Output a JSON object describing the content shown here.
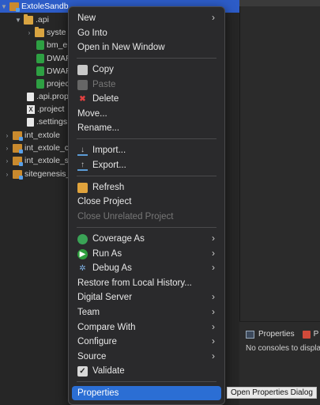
{
  "explorer": {
    "root": "ExtoleSandb",
    "items": [
      {
        "label": ".api"
      },
      {
        "label": "syste"
      },
      {
        "label": "bm_e"
      },
      {
        "label": "DWAR"
      },
      {
        "label": "DWAR"
      },
      {
        "label": "projec"
      },
      {
        "label": ".api.prop"
      },
      {
        "label": ".project"
      },
      {
        "label": ".settings"
      },
      {
        "label": "int_extole"
      },
      {
        "label": "int_extole_c"
      },
      {
        "label": "int_extole_s"
      },
      {
        "label": "sitegenesis_"
      }
    ]
  },
  "menu": {
    "new": "New",
    "go_into": "Go Into",
    "open_new_window": "Open in New Window",
    "copy": "Copy",
    "paste": "Paste",
    "delete": "Delete",
    "move": "Move...",
    "rename": "Rename...",
    "import": "Import...",
    "export": "Export...",
    "refresh": "Refresh",
    "close_project": "Close Project",
    "close_unrelated": "Close Unrelated Project",
    "coverage_as": "Coverage As",
    "run_as": "Run As",
    "debug_as": "Debug As",
    "restore_history": "Restore from Local History...",
    "digital_server": "Digital Server",
    "team": "Team",
    "compare_with": "Compare With",
    "configure": "Configure",
    "source": "Source",
    "validate": "Validate",
    "properties": "Properties",
    "chevron": "›"
  },
  "tooltip": "Open Properties Dialog",
  "console_panel": {
    "tab_properties": "Properties",
    "tab_other": "P",
    "message": "No consoles to displa"
  }
}
